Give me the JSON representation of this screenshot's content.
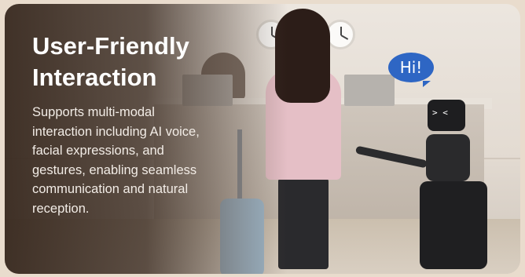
{
  "card": {
    "title_line1": "User-Friendly",
    "title_line2": "Interaction",
    "description_lines": [
      "Supports multi-modal",
      "interaction including AI voice,",
      "facial expressions, and",
      "gestures, enabling seamless",
      "communication and natural",
      "reception."
    ]
  },
  "scene": {
    "speech_bubble_text": "Hi!",
    "robot_face": "> <"
  },
  "colors": {
    "bubble": "#2e66c4",
    "overlay_dark": "#37281e",
    "text": "#ffffff"
  }
}
